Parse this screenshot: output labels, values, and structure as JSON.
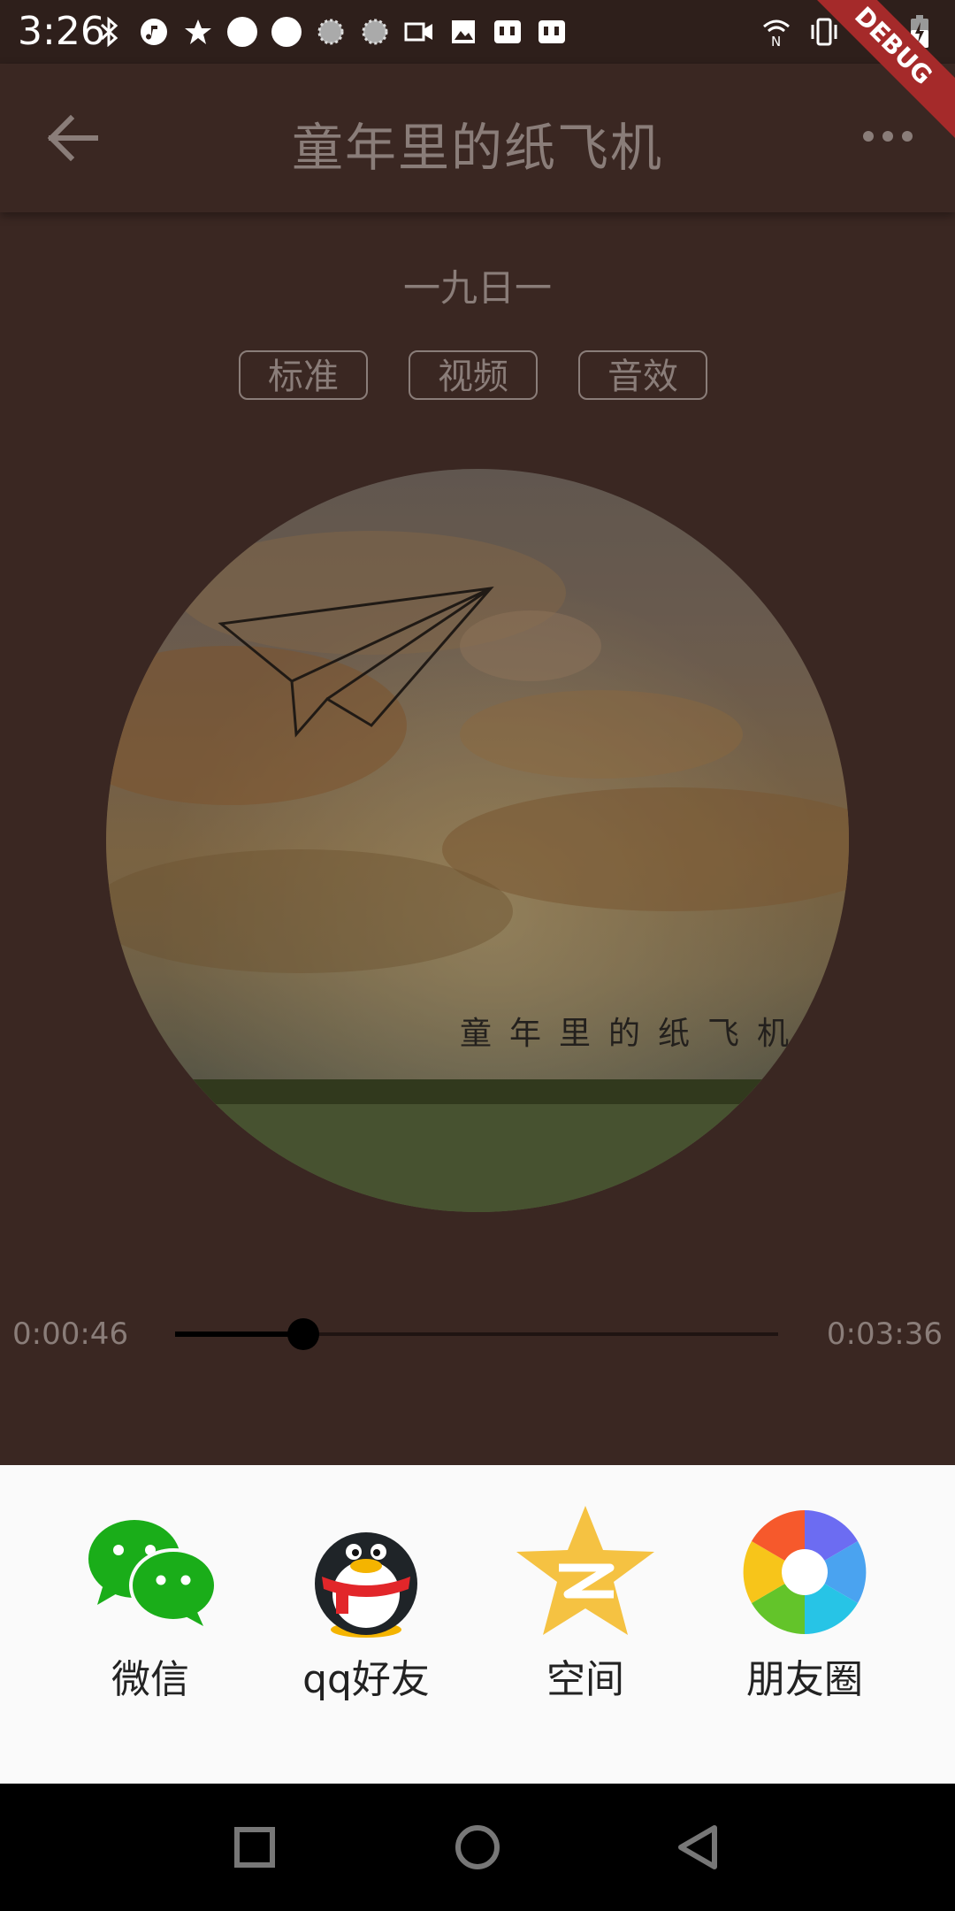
{
  "status_bar": {
    "time": "3:26",
    "left_icons": [
      "bluetooth-icon",
      "music-note-icon",
      "star-icon",
      "circle-icon",
      "circle-icon",
      "dotted-circle-icon",
      "dotted-circle-icon",
      "video-icon",
      "image-icon",
      "notification-icon",
      "notification-icon"
    ],
    "right_icons": [
      "nfc-wifi-icon",
      "vibrate-icon",
      "wifi-icon",
      "battery-charging-icon"
    ]
  },
  "debug_banner": "DEBUG",
  "app_bar": {
    "title": "童年里的纸飞机",
    "back_icon": "arrow-back-icon",
    "more_icon": "more-horizontal-icon"
  },
  "artist": "一九日一",
  "modes": [
    "标准",
    "视频",
    "音效"
  ],
  "cover": {
    "caption": "童年里的纸飞机"
  },
  "player": {
    "elapsed": "0:00:46",
    "duration": "0:03:36",
    "progress": 0.213
  },
  "share": [
    {
      "label": "微信",
      "icon": "wechat-icon"
    },
    {
      "label": "qq好友",
      "icon": "qq-penguin-icon"
    },
    {
      "label": "空间",
      "icon": "qzone-star-icon"
    },
    {
      "label": "朋友圈",
      "icon": "moments-aperture-icon"
    }
  ],
  "nav": [
    "recents-square-icon",
    "home-circle-icon",
    "back-triangle-icon"
  ],
  "colors": {
    "background": "#3a2722",
    "muted_text": "#8a7d79",
    "sheet": "#fafafa",
    "debug_ribbon": "#a52a2a"
  }
}
